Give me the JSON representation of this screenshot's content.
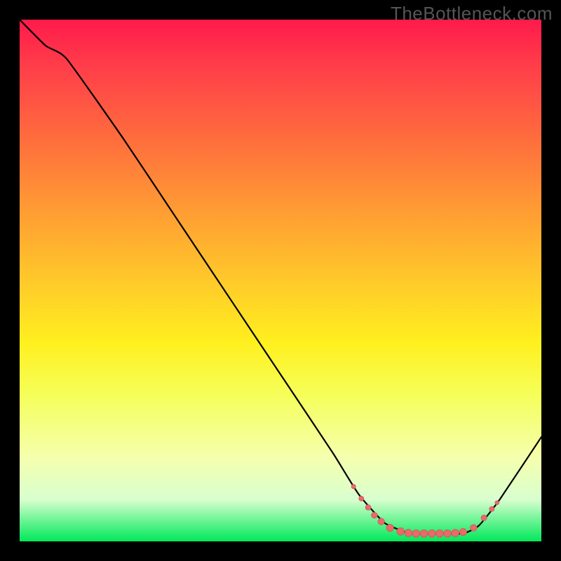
{
  "watermark": "TheBottleneck.com",
  "colors": {
    "page_bg": "#000000",
    "curve": "#000000",
    "dot_fill": "#e86a6a",
    "dot_stroke": "#d04f4f",
    "gradient_stops": [
      "#ff1a4b",
      "#ff3a4a",
      "#ff6a3e",
      "#ff9a34",
      "#ffc92a",
      "#fff01f",
      "#f5ff5a",
      "#f5ffae",
      "#d8ffcf",
      "#00e85a"
    ]
  },
  "chart_data": {
    "type": "line",
    "title": "",
    "xlabel": "",
    "ylabel": "",
    "xlim": [
      0,
      100
    ],
    "ylim": [
      0,
      100
    ],
    "grid": false,
    "legend": false,
    "curve": [
      {
        "x": 0,
        "y": 100
      },
      {
        "x": 5,
        "y": 95
      },
      {
        "x": 9,
        "y": 92.5
      },
      {
        "x": 20,
        "y": 77
      },
      {
        "x": 30,
        "y": 62
      },
      {
        "x": 40,
        "y": 47
      },
      {
        "x": 50,
        "y": 32
      },
      {
        "x": 60,
        "y": 17
      },
      {
        "x": 65,
        "y": 9
      },
      {
        "x": 70,
        "y": 3.5
      },
      {
        "x": 75,
        "y": 1.5
      },
      {
        "x": 80,
        "y": 1.5
      },
      {
        "x": 85,
        "y": 1.5
      },
      {
        "x": 88,
        "y": 3
      },
      {
        "x": 92,
        "y": 8
      },
      {
        "x": 100,
        "y": 20
      }
    ],
    "valley_dots": [
      {
        "x": 64,
        "y": 10.5,
        "r": 3.2
      },
      {
        "x": 65.5,
        "y": 8.2,
        "r": 3.6
      },
      {
        "x": 66.8,
        "y": 6.5,
        "r": 4.0
      },
      {
        "x": 68,
        "y": 5.0,
        "r": 4.4
      },
      {
        "x": 69.3,
        "y": 3.8,
        "r": 4.8
      },
      {
        "x": 71,
        "y": 2.6,
        "r": 5.2
      },
      {
        "x": 73,
        "y": 1.9,
        "r": 5.4
      },
      {
        "x": 74.5,
        "y": 1.6,
        "r": 5.4
      },
      {
        "x": 76,
        "y": 1.5,
        "r": 5.4
      },
      {
        "x": 77.5,
        "y": 1.5,
        "r": 5.4
      },
      {
        "x": 79,
        "y": 1.5,
        "r": 5.4
      },
      {
        "x": 80.5,
        "y": 1.5,
        "r": 5.4
      },
      {
        "x": 82,
        "y": 1.5,
        "r": 5.4
      },
      {
        "x": 83.5,
        "y": 1.6,
        "r": 5.4
      },
      {
        "x": 85,
        "y": 1.8,
        "r": 5.2
      },
      {
        "x": 87,
        "y": 2.6,
        "r": 4.8
      },
      {
        "x": 89,
        "y": 4.5,
        "r": 4.2
      },
      {
        "x": 90.5,
        "y": 6.2,
        "r": 3.6
      },
      {
        "x": 91.5,
        "y": 7.4,
        "r": 3.0
      }
    ]
  }
}
